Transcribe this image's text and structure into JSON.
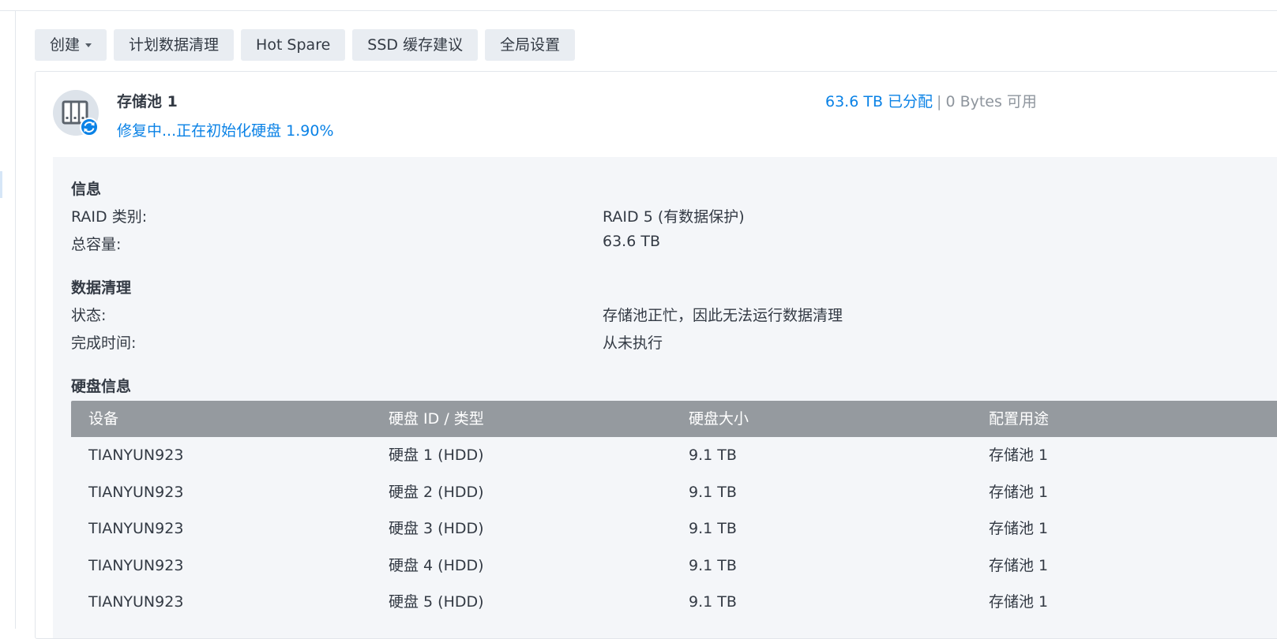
{
  "toolbar": {
    "create_label": "创建",
    "scrub_plan_label": "计划数据清理",
    "hot_spare_label": "Hot Spare",
    "ssd_cache_label": "SSD 缓存建议",
    "global_settings_label": "全局设置"
  },
  "pool": {
    "title": "存储池 1",
    "status": "修复中...正在初始化硬盘 1.90%",
    "allocated": "63.6 TB 已分配",
    "separator": "|",
    "available": "0 Bytes 可用",
    "status_color": "#0a82e6"
  },
  "info": {
    "title": "信息",
    "raid_label": "RAID 类别:",
    "raid_value": "RAID 5 (有数据保护)",
    "capacity_label": "总容量:",
    "capacity_value": "63.6 TB"
  },
  "scrub": {
    "title": "数据清理",
    "status_label": "状态:",
    "status_value": "存储池正忙，因此无法运行数据清理",
    "finish_label": "完成时间:",
    "finish_value": "从未执行"
  },
  "disks": {
    "title": "硬盘信息",
    "headers": [
      "设备",
      "硬盘 ID / 类型",
      "硬盘大小",
      "配置用途"
    ],
    "rows": [
      [
        "TIANYUN923",
        "硬盘 1 (HDD)",
        "9.1 TB",
        "存储池 1"
      ],
      [
        "TIANYUN923",
        "硬盘 2 (HDD)",
        "9.1 TB",
        "存储池 1"
      ],
      [
        "TIANYUN923",
        "硬盘 3 (HDD)",
        "9.1 TB",
        "存储池 1"
      ],
      [
        "TIANYUN923",
        "硬盘 4 (HDD)",
        "9.1 TB",
        "存储池 1"
      ],
      [
        "TIANYUN923",
        "硬盘 5 (HDD)",
        "9.1 TB",
        "存储池 1"
      ]
    ]
  },
  "icons": {
    "pool": "storage-pool-icon",
    "repair": "sync-icon",
    "dropdown": "caret-down-icon"
  }
}
